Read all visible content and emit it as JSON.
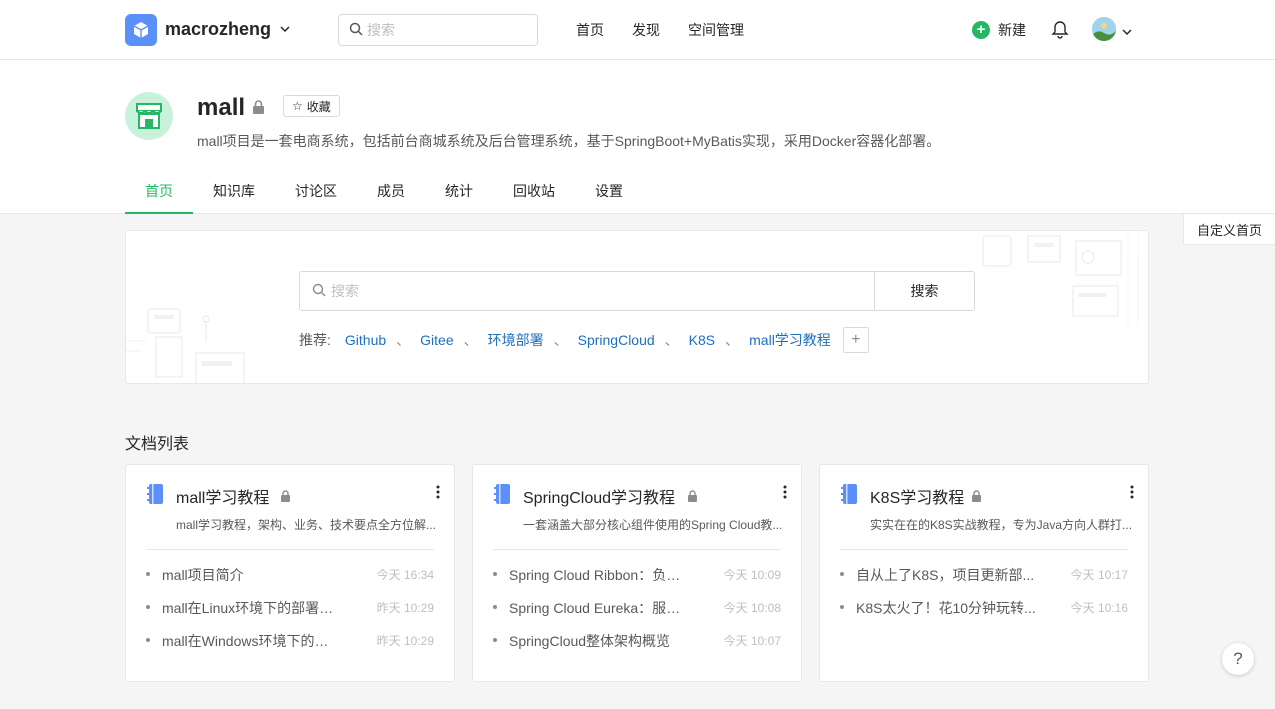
{
  "topbar": {
    "space_name": "macrozheng",
    "search_placeholder": "搜索",
    "nav": [
      "首页",
      "发现",
      "空间管理"
    ],
    "new_label": "新建",
    "accent": "#25b864"
  },
  "space": {
    "title": "mall",
    "fav_label": "收藏",
    "description": "mall项目是一套电商系统，包括前台商城系统及后台管理系统，基于SpringBoot+MyBatis实现，采用Docker容器化部署。",
    "tabs": [
      "首页",
      "知识库",
      "讨论区",
      "成员",
      "统计",
      "回收站",
      "设置"
    ],
    "active_tab": "首页"
  },
  "customize_label": "自定义首页",
  "search_panel": {
    "placeholder": "搜索",
    "button_label": "搜索",
    "recommend_label": "推荐:",
    "recommend_links": [
      "Github",
      "Gitee",
      "环境部署",
      "SpringCloud",
      "K8S",
      "mall学习教程"
    ],
    "separator": "、",
    "add_label": "+"
  },
  "section_title": "文档列表",
  "cards": [
    {
      "title": "mall学习教程",
      "description": "mall学习教程，架构、业务、技术要点全方位解...",
      "docs": [
        {
          "name": "mall项目简介",
          "time": "今天 16:34"
        },
        {
          "name": "mall在Linux环境下的部署（...",
          "time": "昨天 10:29"
        },
        {
          "name": "mall在Windows环境下的部署",
          "time": "昨天 10:29"
        }
      ]
    },
    {
      "title": "SpringCloud学习教程",
      "description": "一套涵盖大部分核心组件使用的Spring Cloud教...",
      "docs": [
        {
          "name": "Spring Cloud Ribbon：负载...",
          "time": "今天 10:09"
        },
        {
          "name": "Spring Cloud Eureka：服务...",
          "time": "今天 10:08"
        },
        {
          "name": "SpringCloud整体架构概览",
          "time": "今天 10:07"
        }
      ]
    },
    {
      "title": "K8S学习教程",
      "description": "实实在在的K8S实战教程，专为Java方向人群打...",
      "docs": [
        {
          "name": "自从上了K8S，项目更新部...",
          "time": "今天 10:17"
        },
        {
          "name": "K8S太火了！花10分钟玩转...",
          "time": "今天 10:16"
        }
      ]
    }
  ],
  "help_label": "?"
}
